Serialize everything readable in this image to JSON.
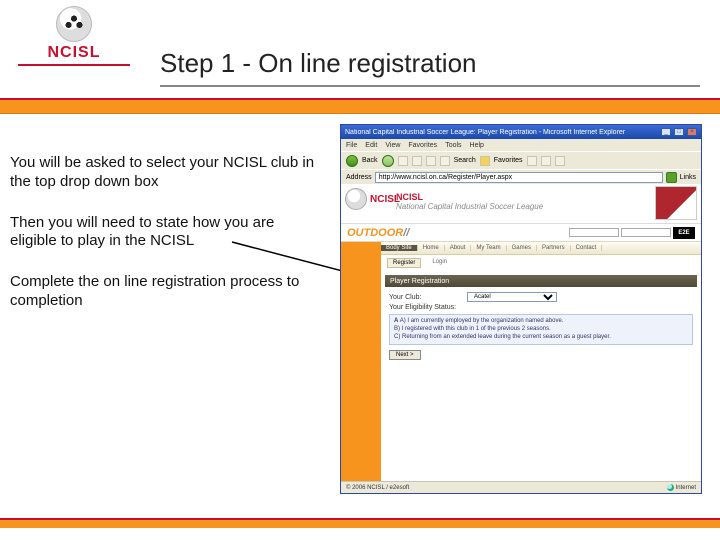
{
  "slide": {
    "title": "Step 1 - On line registration",
    "logo_text": "NCISL"
  },
  "body": {
    "p1": "You will be asked to select your NCISL club in the top drop down box",
    "p2": "Then you will need to state how you are eligible to play in the NCISL",
    "p3": "Complete the on line registration process to completion"
  },
  "browser": {
    "title": "National Capital Industrial Soccer League: Player Registration - Microsoft Internet Explorer",
    "menu": [
      "File",
      "Edit",
      "View",
      "Favorites",
      "Tools",
      "Help"
    ],
    "back_label": "Back",
    "fav_label": "Favorites",
    "search_label": "Search",
    "address_label": "Address",
    "address_value": "http://www.ncisl.on.ca/Register/Player.aspx",
    "links_label": "Links",
    "status_left": "© 2006 NCISL / e2esoft",
    "status_right": "Internet"
  },
  "page": {
    "league_acronym": "NCISL",
    "league_full": "National Capital Industrial Soccer League",
    "outdoor": "OUTDOOR",
    "outdoor_slashes": "//",
    "sponsor": "E2E",
    "menu": {
      "active": "Body Site",
      "items": [
        "Home",
        "About",
        "My Team",
        "Games",
        "Partners",
        "Contact"
      ]
    },
    "subtabs": [
      "Register",
      "Login"
    ],
    "section_header": "Player Registration",
    "label_club": "Your Club:",
    "club_value": "Acatel",
    "label_elig": "Your Eligibility Status:",
    "elig_a": "A) I am currently employed by the organization named above.",
    "elig_b": "B) I registered with this club in 1 of the previous 2 seasons.",
    "elig_c": "C) Returning from an extended leave during the current season as a guest player.",
    "elig_radio": "A",
    "next_btn": "Next >"
  }
}
